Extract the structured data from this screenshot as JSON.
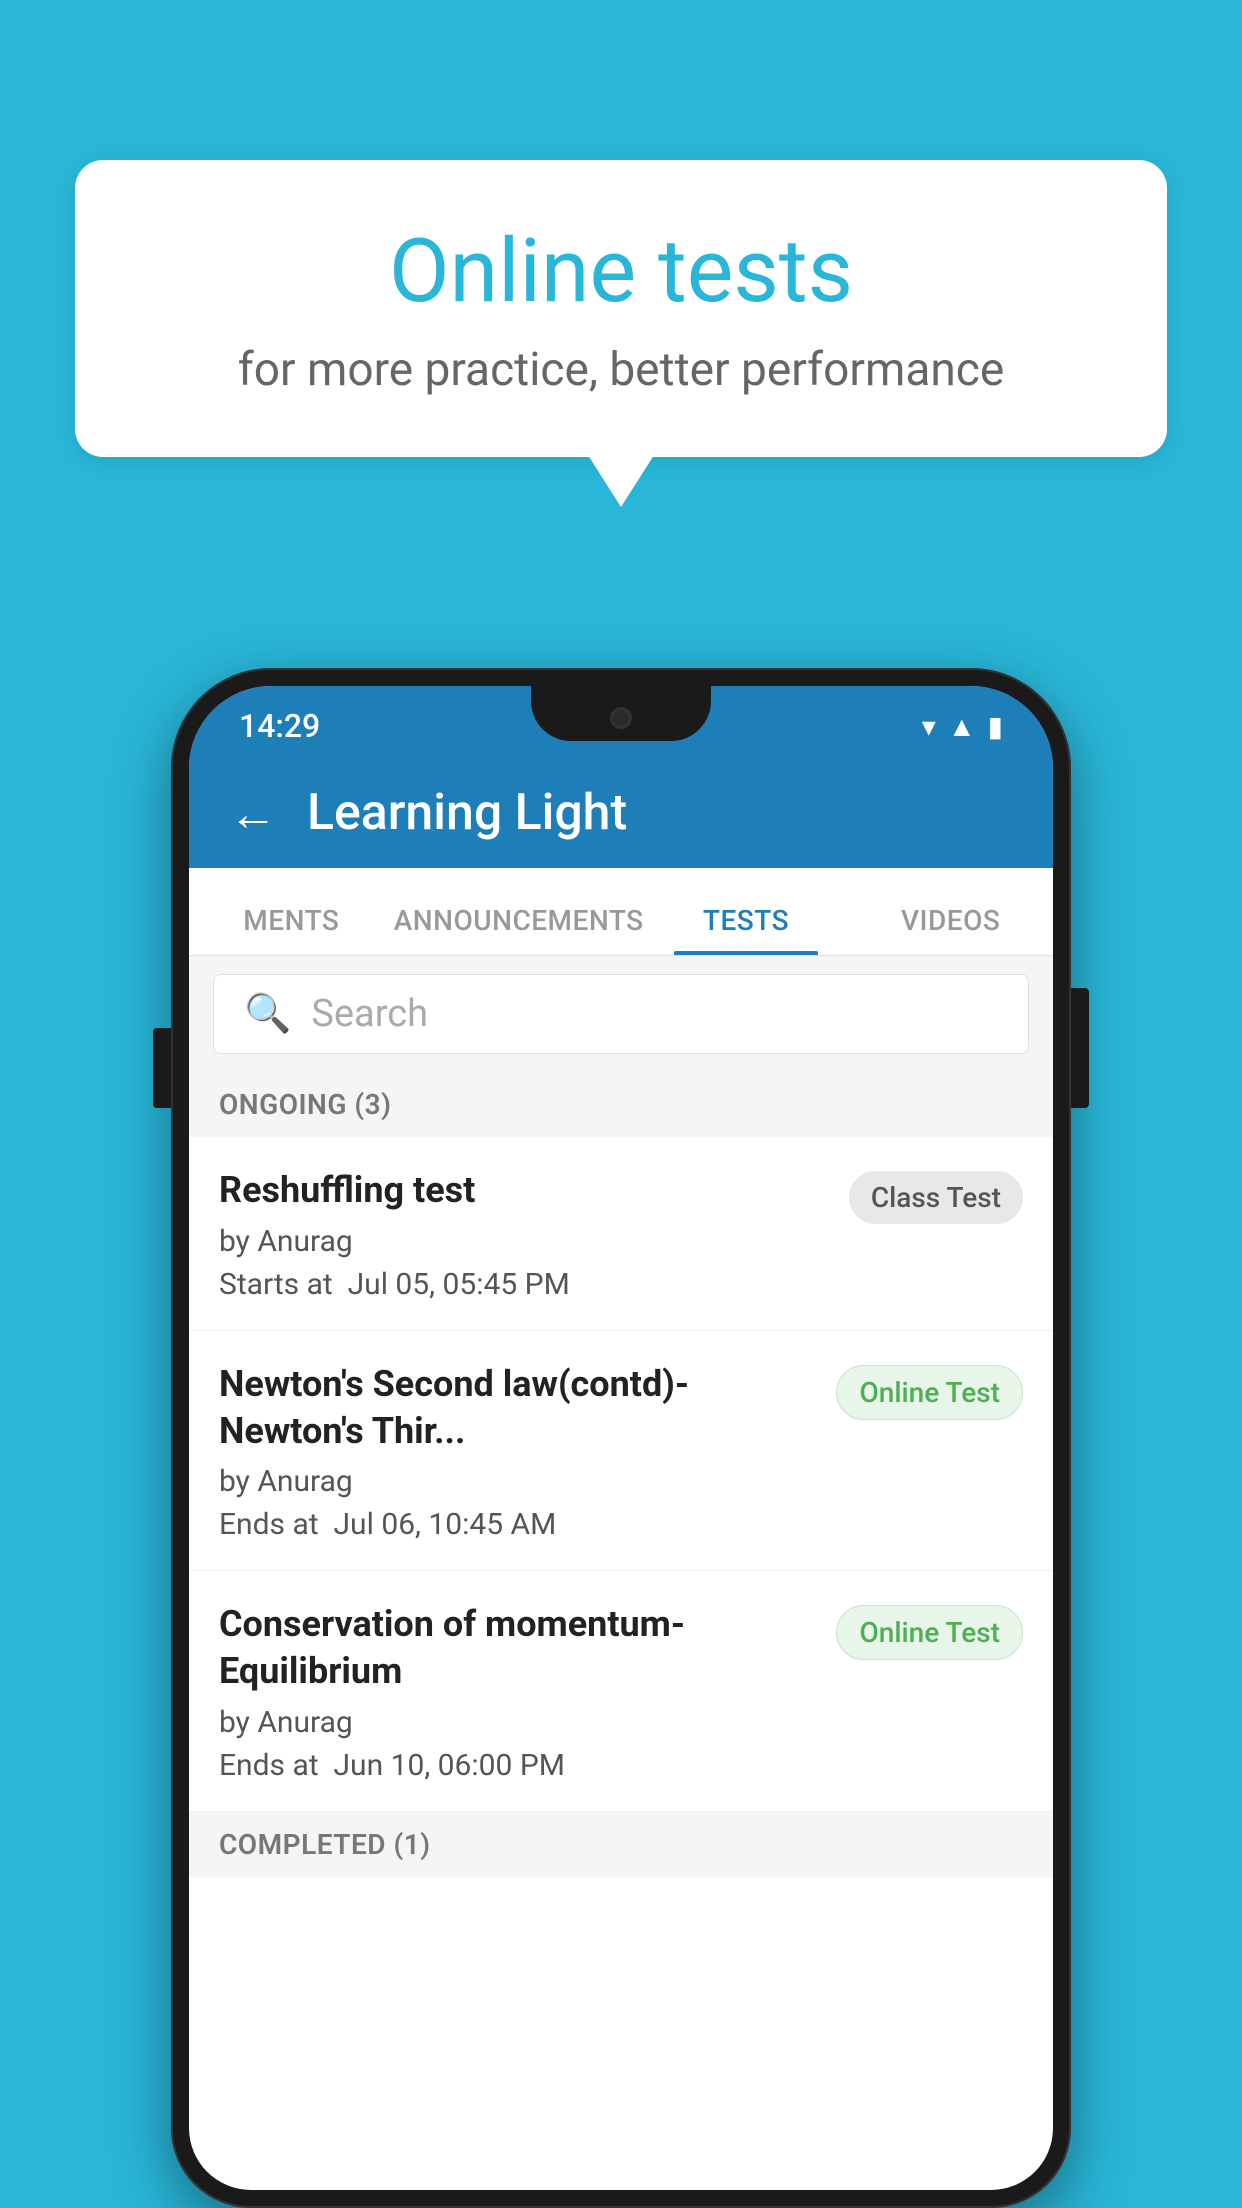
{
  "background_color": "#29b6d8",
  "speech_bubble": {
    "title": "Online tests",
    "subtitle": "for more practice, better performance"
  },
  "phone": {
    "status_bar": {
      "time": "14:29",
      "icons": [
        "wifi",
        "signal",
        "battery"
      ]
    },
    "app_bar": {
      "back_label": "←",
      "title": "Learning Light"
    },
    "tabs": [
      {
        "label": "MENTS",
        "active": false
      },
      {
        "label": "ANNOUNCEMENTS",
        "active": false
      },
      {
        "label": "TESTS",
        "active": true
      },
      {
        "label": "VIDEOS",
        "active": false
      }
    ],
    "search": {
      "placeholder": "Search"
    },
    "ongoing_section": {
      "header": "ONGOING (3)",
      "items": [
        {
          "name": "Reshuffling test",
          "author": "by Anurag",
          "time_label": "Starts at",
          "time_value": "Jul 05, 05:45 PM",
          "badge": "Class Test",
          "badge_type": "class"
        },
        {
          "name": "Newton's Second law(contd)-Newton's Thir...",
          "author": "by Anurag",
          "time_label": "Ends at",
          "time_value": "Jul 06, 10:45 AM",
          "badge": "Online Test",
          "badge_type": "online"
        },
        {
          "name": "Conservation of momentum-Equilibrium",
          "author": "by Anurag",
          "time_label": "Ends at",
          "time_value": "Jun 10, 06:00 PM",
          "badge": "Online Test",
          "badge_type": "online"
        }
      ]
    },
    "completed_section": {
      "header": "COMPLETED (1)"
    }
  }
}
